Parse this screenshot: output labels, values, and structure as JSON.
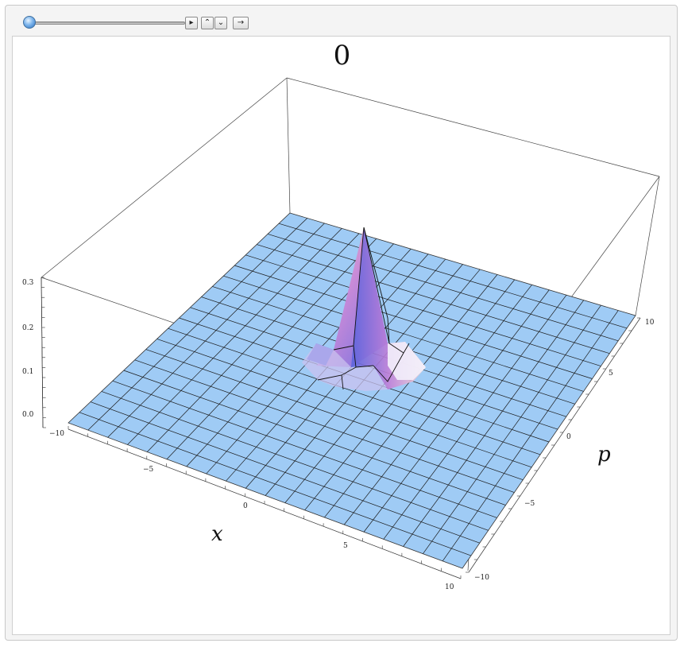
{
  "manipulator": {
    "slider_value": 0,
    "play_icon": "▸",
    "faster_icon": "⌃",
    "slower_icon": "⌄",
    "direction_icon": "→"
  },
  "plot": {
    "title": "0",
    "z_ticks": [
      "0.0",
      "0.1",
      "0.2",
      "0.3"
    ],
    "x_ticks": [
      "−10",
      "−5",
      "0",
      "5",
      "10"
    ],
    "p_ticks": [
      "−10",
      "−5",
      "0",
      "5",
      "10"
    ],
    "x_label": "x",
    "p_label": "p",
    "surface_color": "#9fcbf5",
    "peak_colors": [
      "#4f5fe0",
      "#b07ad6",
      "#f7c9b8"
    ]
  }
}
